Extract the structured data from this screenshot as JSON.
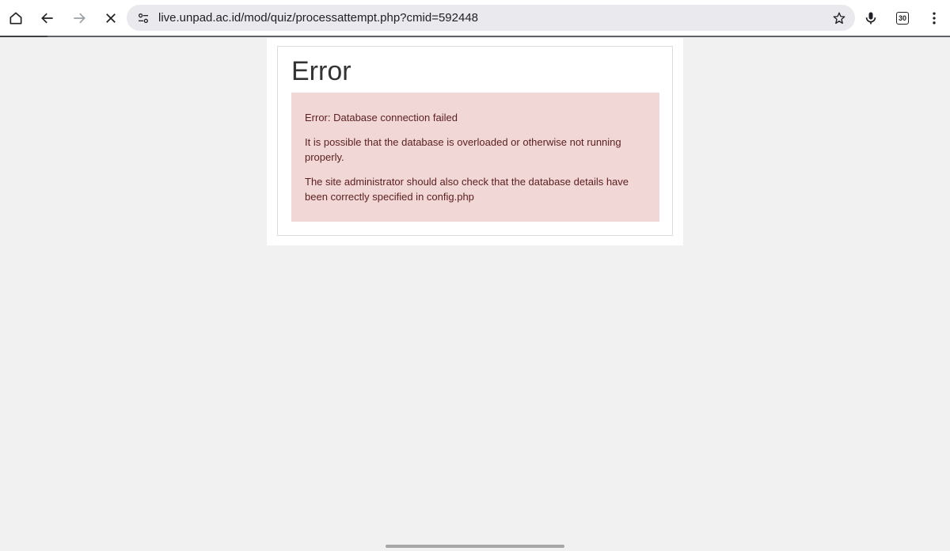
{
  "browser": {
    "url": "live.unpad.ac.id/mod/quiz/processattempt.php?cmid=592448",
    "tab_count": "30",
    "icons": {
      "home": "home-icon",
      "back": "back-arrow-icon",
      "forward": "forward-arrow-icon",
      "stop": "close-icon",
      "site_info": "tune-icon",
      "bookmark": "star-icon",
      "voice": "microphone-icon",
      "tabs": "tab-switcher-icon",
      "menu": "more-vert-icon"
    }
  },
  "page": {
    "title": "Error",
    "messages": [
      "Error: Database connection failed",
      "It is possible that the database is overloaded or otherwise not running properly.",
      "The site administrator should also check that the database details have been correctly specified in config.php"
    ]
  },
  "colors": {
    "alert_background": "#f2d7d7",
    "alert_text": "#5c2020",
    "page_background": "#f1f1f1"
  }
}
